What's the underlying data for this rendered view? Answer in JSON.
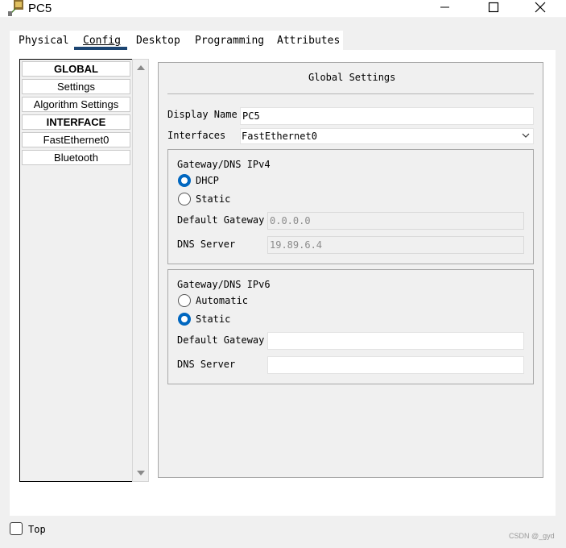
{
  "window": {
    "title": "PC5",
    "controls": {
      "minimize": "minimize-icon",
      "maximize": "maximize-icon",
      "close": "close-icon"
    }
  },
  "tabs": [
    {
      "label": "Physical"
    },
    {
      "label": "Config",
      "active": true
    },
    {
      "label": "Desktop"
    },
    {
      "label": "Programming"
    },
    {
      "label": "Attributes"
    }
  ],
  "sidebar": {
    "items": [
      {
        "label": "GLOBAL",
        "heading": true
      },
      {
        "label": "Settings"
      },
      {
        "label": "Algorithm Settings"
      },
      {
        "label": "INTERFACE",
        "heading": true
      },
      {
        "label": "FastEthernet0"
      },
      {
        "label": "Bluetooth"
      }
    ]
  },
  "settings": {
    "title": "Global Settings",
    "display_name_label": "Display Name",
    "display_name_value": "PC5",
    "interfaces_label": "Interfaces",
    "interfaces_value": "FastEthernet0",
    "ipv4": {
      "title": "Gateway/DNS IPv4",
      "dhcp_label": "DHCP",
      "static_label": "Static",
      "selected": "DHCP",
      "gateway_label": "Default Gateway",
      "gateway_value": "0.0.0.0",
      "dns_label": "DNS Server",
      "dns_value": "19.89.6.4"
    },
    "ipv6": {
      "title": "Gateway/DNS IPv6",
      "automatic_label": "Automatic",
      "static_label": "Static",
      "selected": "Static",
      "gateway_label": "Default Gateway",
      "gateway_value": "",
      "dns_label": "DNS Server",
      "dns_value": ""
    }
  },
  "footer": {
    "top_label": "Top",
    "top_checked": false,
    "watermark": "CSDN @_gyd"
  },
  "colors": {
    "accent": "#0067c0",
    "tab_underline": "#1c4572"
  }
}
